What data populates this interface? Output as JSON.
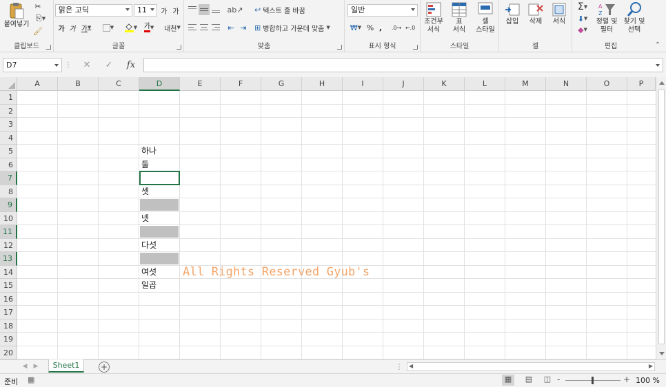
{
  "ribbon": {
    "clipboard": {
      "paste_label": "붙여넣기",
      "group_label": "클립보드"
    },
    "font": {
      "font_name": "맑은 고딕",
      "font_size": "11",
      "grow_label": "가",
      "shrink_label": "가",
      "bold_label": "가",
      "italic_label": "가",
      "underline_label": "가",
      "color_label": "가",
      "phonetic_label": "내천",
      "group_label": "글꼴"
    },
    "alignment": {
      "wrap_label": "텍스트 줄 바꿈",
      "merge_label": "병합하고 가운데 맞춤",
      "group_label": "맞춤"
    },
    "number": {
      "format_value": "일반",
      "percent_label": "%",
      "comma_label": ",",
      "group_label": "표시 형식"
    },
    "styles": {
      "conditional_label_1": "조건부",
      "conditional_label_2": "서식",
      "table_label_1": "표",
      "table_label_2": "서식",
      "cell_label_1": "셀",
      "cell_label_2": "스타일",
      "group_label": "스타일"
    },
    "cells": {
      "insert_label": "삽입",
      "delete_label": "삭제",
      "format_label": "서식",
      "group_label": "셀"
    },
    "editing": {
      "sum_label": "Σ",
      "sort_label_1": "정렬 및",
      "sort_label_2": "필터",
      "find_label_1": "찾기 및",
      "find_label_2": "선택",
      "group_label": "편집"
    }
  },
  "formula_bar": {
    "name_box": "D7",
    "fx_label": "fx",
    "value": ""
  },
  "grid": {
    "columns": [
      "A",
      "B",
      "C",
      "D",
      "E",
      "F",
      "G",
      "H",
      "I",
      "J",
      "K",
      "L",
      "M",
      "N",
      "O",
      "P"
    ],
    "selected_column": "D",
    "rows": [
      "1",
      "2",
      "3",
      "4",
      "5",
      "6",
      "7",
      "8",
      "9",
      "10",
      "11",
      "12",
      "13",
      "14",
      "15",
      "16",
      "17",
      "18",
      "19",
      "20"
    ],
    "highlighted_rows": [
      "7",
      "9",
      "11",
      "13"
    ],
    "active_cell": "D7",
    "cells": {
      "D5": "하나",
      "D6": "둘",
      "D8": "셋",
      "D10": "넷",
      "D12": "다섯",
      "D14": "여섯",
      "D15": "일곱"
    },
    "shaded_cells": [
      "D9",
      "D11",
      "D13"
    ],
    "shade_color": "#c0c0c0",
    "watermark": "All Rights Reserved Gyub's",
    "watermark_color": "#f3a66b"
  },
  "sheets": {
    "tabs": [
      "Sheet1"
    ],
    "active": "Sheet1",
    "add_label": "+"
  },
  "status_bar": {
    "ready_label": "준비",
    "zoom_label": "100 %",
    "zoom_minus": "-",
    "zoom_plus": "+"
  },
  "accent_color": "#217346"
}
